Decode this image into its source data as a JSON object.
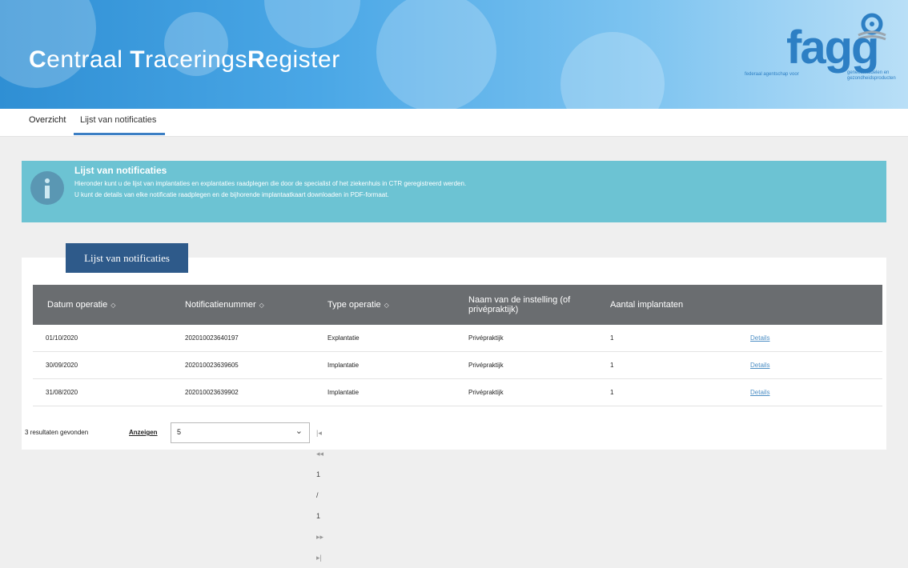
{
  "banner": {
    "title_parts": [
      "C",
      "entraal ",
      "T",
      "racerings",
      "R",
      "egister"
    ],
    "logo_word": "fagg",
    "logo_sub_left": "federaal agentschap voor",
    "logo_sub_right": "geneesmiddelen en gezondheidsproducten"
  },
  "nav": {
    "tabs": [
      {
        "label": "Overzicht"
      },
      {
        "label": "Lijst van notificaties"
      }
    ],
    "active_tab": "Lijst van notificaties"
  },
  "info": {
    "title": "Lijst van notificaties",
    "line1": "Hieronder kunt u de lijst van implantaties en explantaties raadplegen die door de specialist of het ziekenhuis in CTR geregistreerd werden.",
    "line2": "U kunt de details van elke notificatie raadplegen en de bijhorende implantaatkaart downloaden in PDF-formaat."
  },
  "panel_tab": "Lijst van notificaties",
  "table": {
    "columns": [
      "Datum operatie",
      "Notificatienummer",
      "Type operatie",
      "Naam van de instelling (of privépraktijk)",
      "Aantal implantaten"
    ],
    "rows": [
      {
        "datum": "01/10/2020",
        "nummer": "202010023640197",
        "type": "Explantatie",
        "instelling": "Privépraktijk",
        "aantal": "1",
        "link": "Details"
      },
      {
        "datum": "30/09/2020",
        "nummer": "202010023639605",
        "type": "Implantatie",
        "instelling": "Privépraktijk",
        "aantal": "1",
        "link": "Details"
      },
      {
        "datum": "31/08/2020",
        "nummer": "202010023639902",
        "type": "Implantatie",
        "instelling": "Privépraktijk",
        "aantal": "1",
        "link": "Details"
      }
    ]
  },
  "footer": {
    "results": "3 resultaten gevonden",
    "show_label": "Anzeigen",
    "page_size": "5",
    "first": "|◂",
    "prev": "◂◂",
    "pages": "1 / 1",
    "next": "▸▸",
    "last": "▸|"
  },
  "colors": {
    "banner_start": "#2f8fd4",
    "info_bg": "#6cc3d3",
    "header_bg": "#6a6d70",
    "panel_tab_bg": "#2e5a8a",
    "link": "#4c8ec4"
  }
}
